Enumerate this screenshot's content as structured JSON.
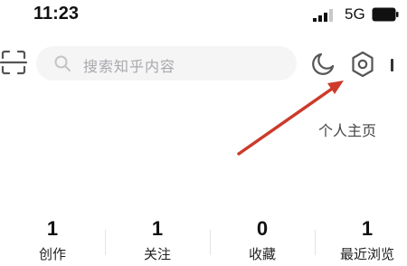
{
  "status_bar": {
    "time": "11:23",
    "network": "5G"
  },
  "search": {
    "placeholder": "搜索知乎内容"
  },
  "profile": {
    "link_label": "个人主页"
  },
  "stats": [
    {
      "value": "1",
      "label": "创作"
    },
    {
      "value": "1",
      "label": "关注"
    },
    {
      "value": "0",
      "label": "收藏"
    },
    {
      "value": "1",
      "label": "最近浏览"
    }
  ],
  "icons": {
    "scan": "scan-icon",
    "search": "search-icon",
    "night_mode": "moon-icon",
    "settings": "settings-icon",
    "battery": "battery-icon",
    "signal": "signal-icon"
  },
  "colors": {
    "annotation_arrow": "#cc3b2b",
    "search_bg": "#f5f5f6"
  }
}
